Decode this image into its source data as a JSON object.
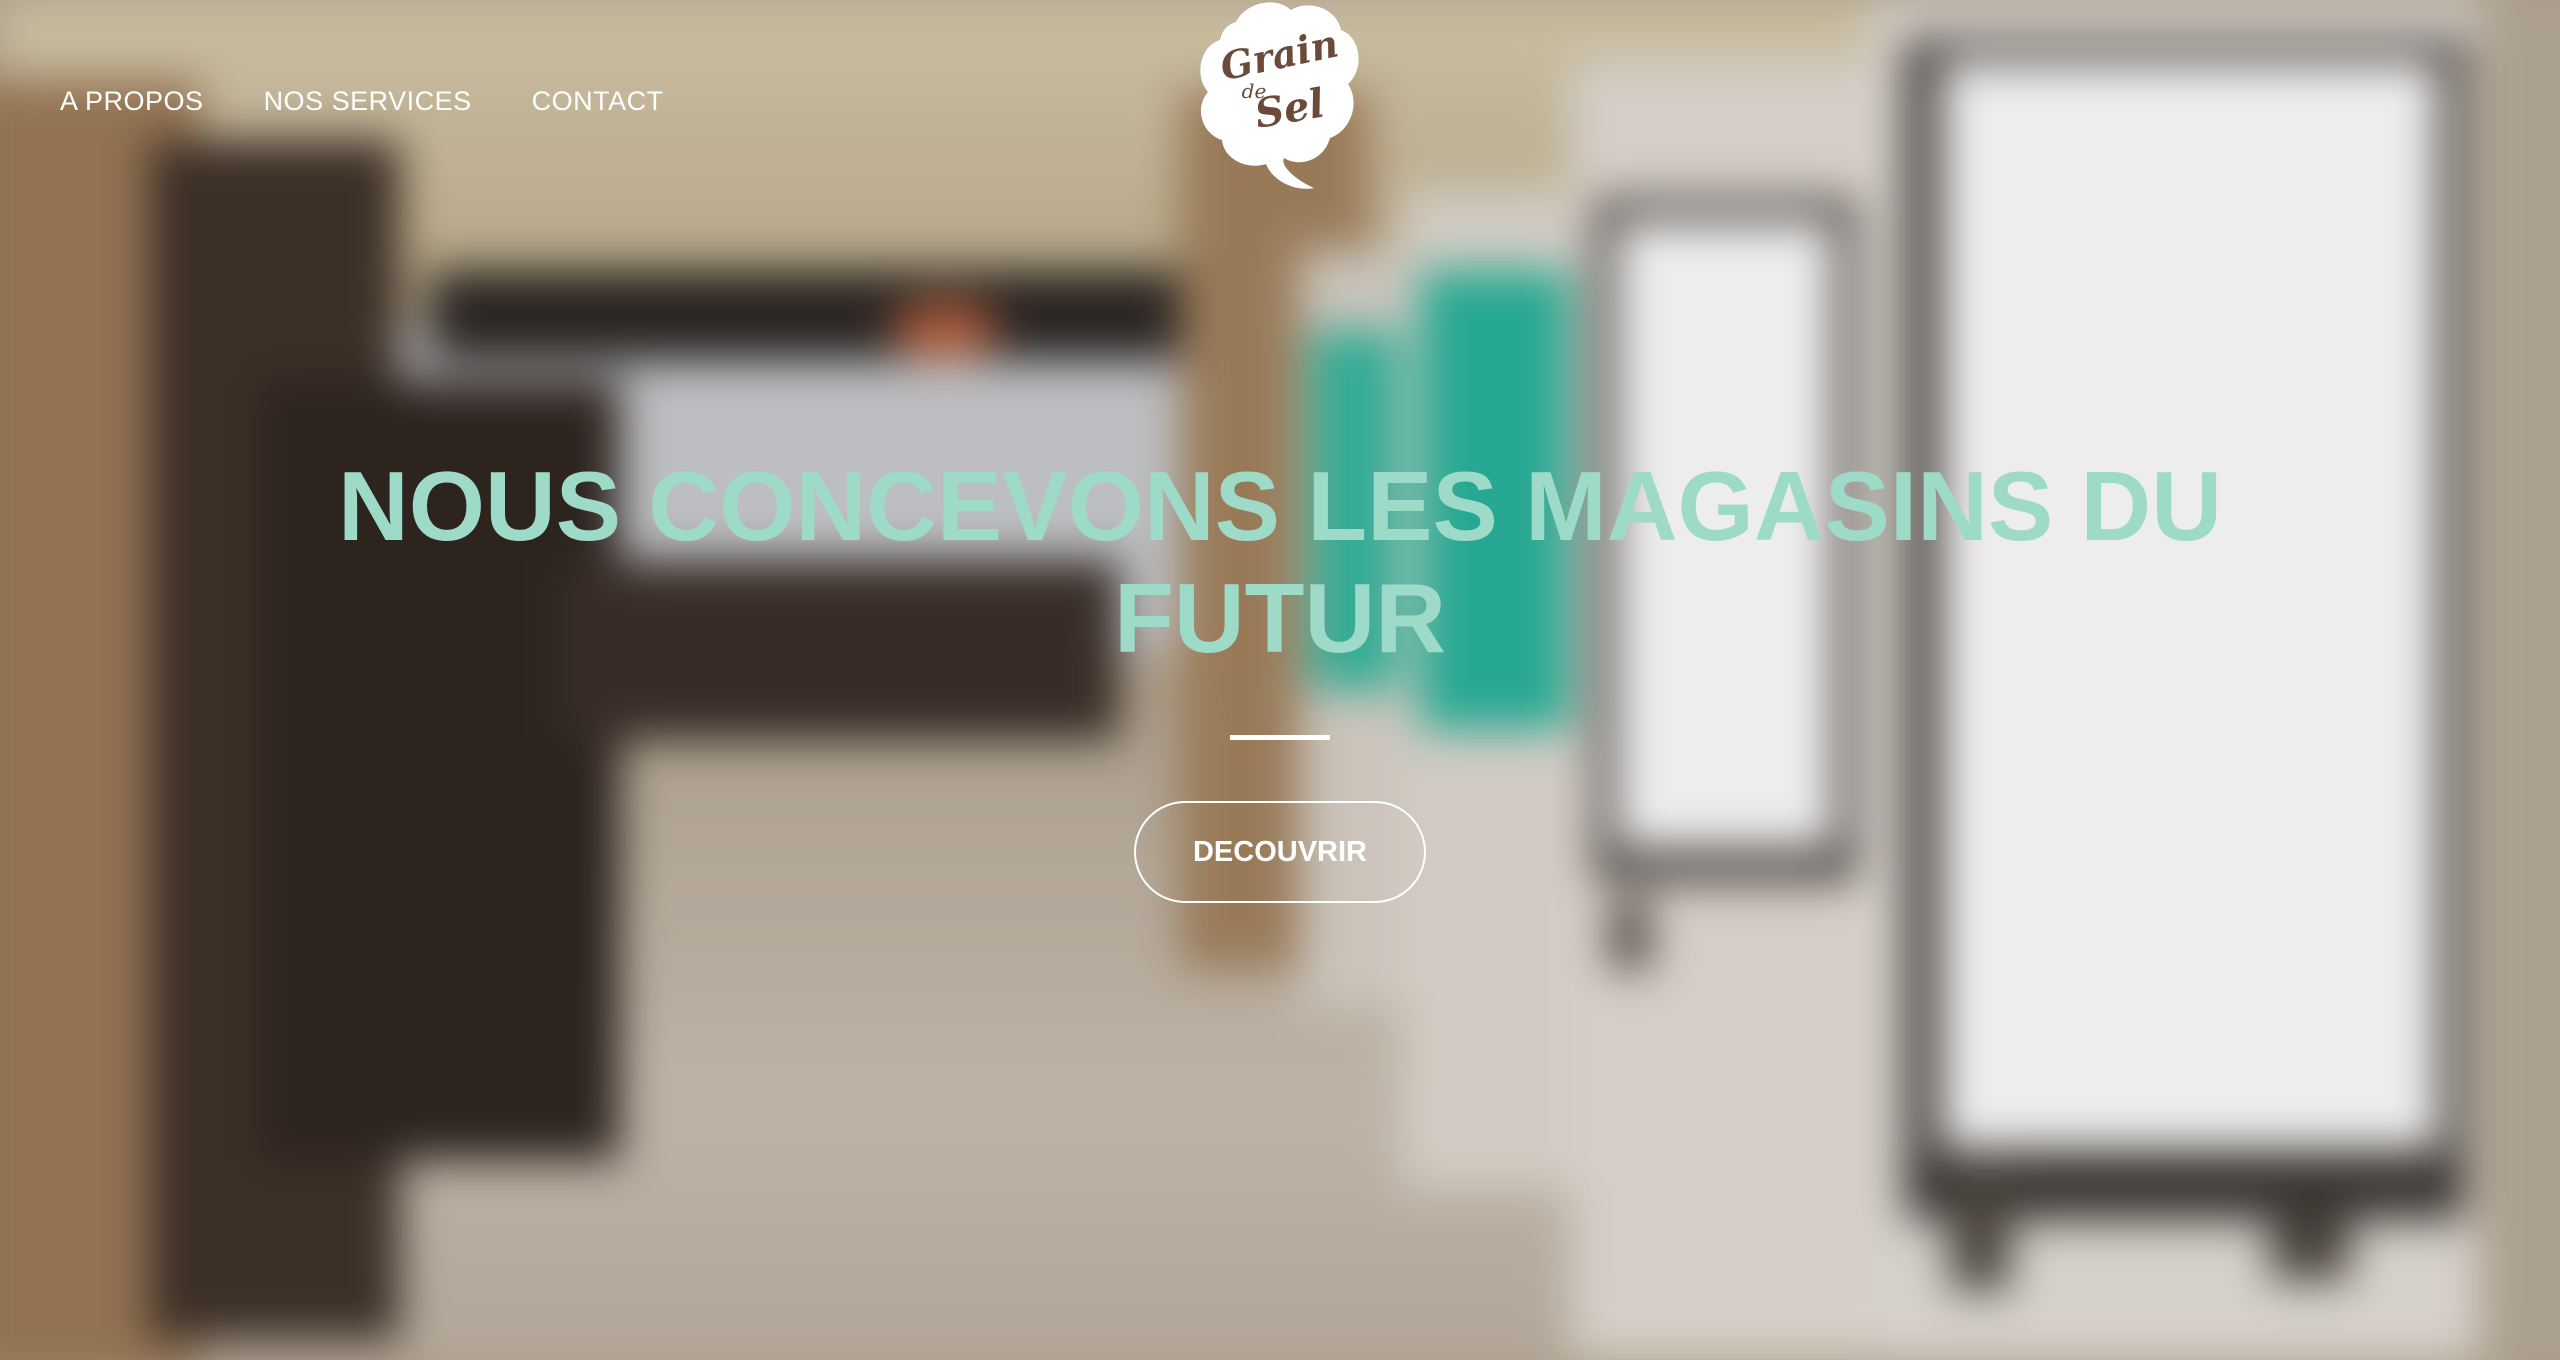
{
  "nav": {
    "items": [
      {
        "label": "A PROPOS"
      },
      {
        "label": "NOS SERVICES"
      },
      {
        "label": "CONTACT"
      }
    ]
  },
  "logo": {
    "line1": "Grain",
    "line2": "de",
    "line3": "Sel",
    "brand_color": "#6b4a3a"
  },
  "hero": {
    "headline": "NOUS CONCEVONS LES MAGASINS DU FUTUR",
    "cta_label": "DECOUVRIR",
    "headline_color": "#9edac8",
    "background_description_icon": "store-kiosks-background"
  }
}
